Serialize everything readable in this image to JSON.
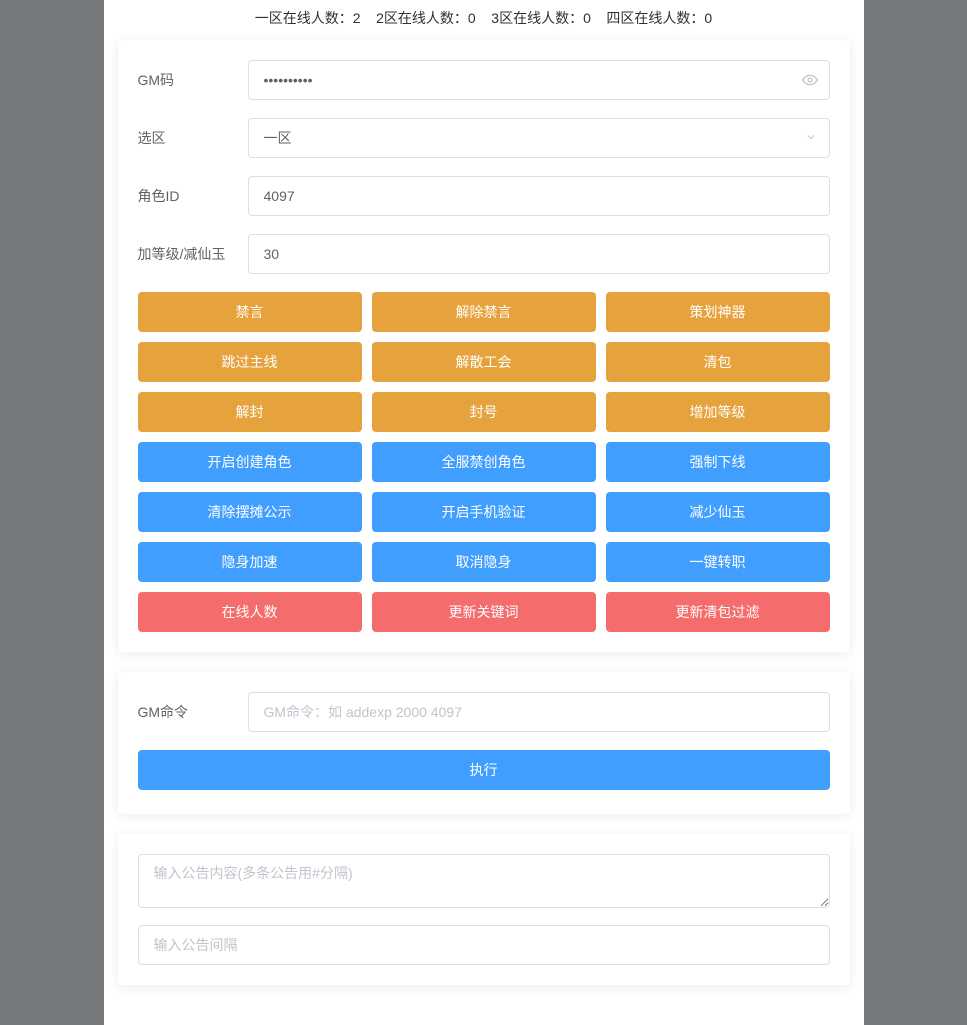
{
  "header": {
    "zone1_label": "一区在线人数：2",
    "zone2_label": "2区在线人数：0",
    "zone3_label": "3区在线人数：0",
    "zone4_label": "四区在线人数：0"
  },
  "form": {
    "gm_code_label": "GM码",
    "gm_code_value": "••••••••••",
    "zone_label": "选区",
    "zone_selected": "一区",
    "role_id_label": "角色ID",
    "role_id_value": "4097",
    "level_label": "加等级/减仙玉",
    "level_value": "30"
  },
  "buttons": {
    "warning": [
      "禁言",
      "解除禁言",
      "策划神器",
      "跳过主线",
      "解散工会",
      "清包",
      "解封",
      "封号",
      "增加等级"
    ],
    "primary": [
      "开启创建角色",
      "全服禁创角色",
      "强制下线",
      "清除摆摊公示",
      "开启手机验证",
      "减少仙玉",
      "隐身加速",
      "取消隐身",
      "一键转职"
    ],
    "danger": [
      "在线人数",
      "更新关键词",
      "更新清包过滤"
    ]
  },
  "command": {
    "label": "GM命令",
    "placeholder": "GM命令：如 addexp 2000 4097",
    "execute": "执行"
  },
  "announce": {
    "content_placeholder": "输入公告内容(多条公告用#分隔)",
    "interval_placeholder": "输入公告间隔"
  }
}
